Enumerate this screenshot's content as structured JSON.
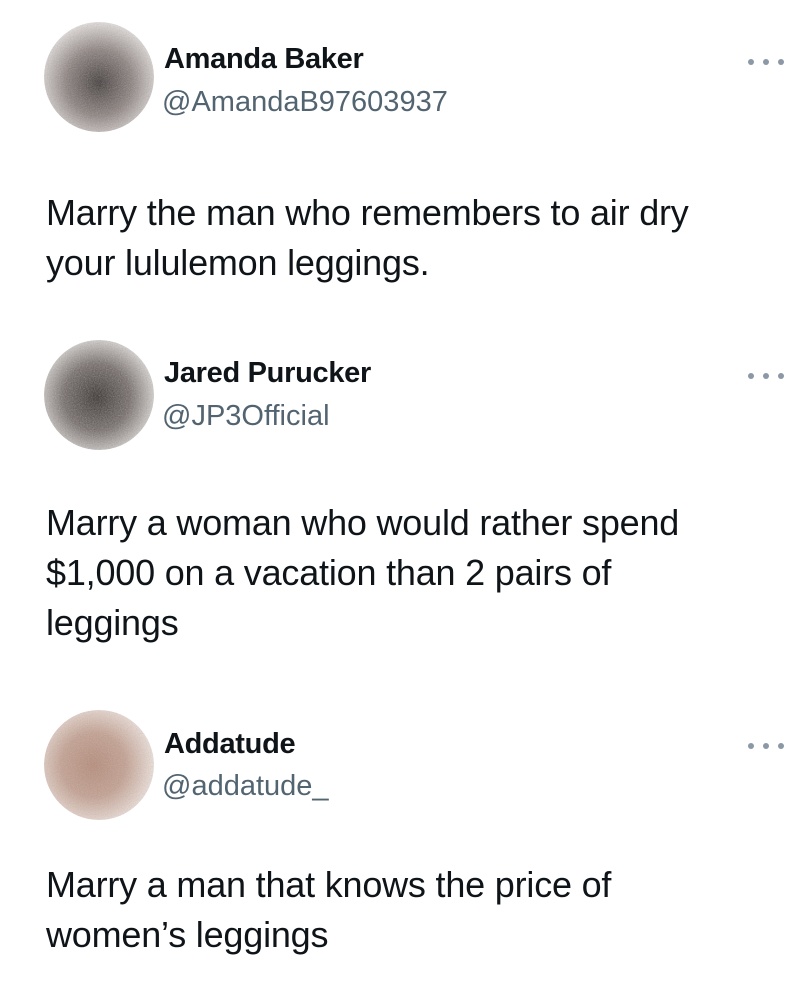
{
  "tweets": [
    {
      "display_name": "Amanda Baker",
      "handle": "@AmandaB97603937",
      "avatar_icon": "blurred-profile-avatar",
      "avatar_colors": [
        "#8a7f7c",
        "#3a3332",
        "#d9d4d2"
      ],
      "more_icon": "more-options-icon",
      "text_lines": [
        "Marry the man who remembers to air dry",
        "your lululemon leggings."
      ]
    },
    {
      "display_name": "Jared Purucker",
      "handle": "@JP3Official",
      "avatar_icon": "blurred-profile-avatar",
      "avatar_colors": [
        "#6f6663",
        "#2e2826",
        "#d7d2cf"
      ],
      "more_icon": "more-options-icon",
      "text_lines": [
        "Marry a woman who would rather spend",
        "$1,000 on a vacation than 2 pairs of",
        "leggings"
      ]
    },
    {
      "display_name": "Addatude",
      "handle": "@addatude_",
      "avatar_icon": "blurred-profile-avatar",
      "avatar_colors": [
        "#c4a090",
        "#8a6a5c",
        "#efe1da"
      ],
      "more_icon": "more-options-icon",
      "text_lines": [
        "Marry a man that knows the price of",
        "women’s leggings"
      ]
    }
  ],
  "colors": {
    "name": "#0f1419",
    "handle": "#536471",
    "more_dots": "#8b98a5",
    "background": "#ffffff"
  }
}
